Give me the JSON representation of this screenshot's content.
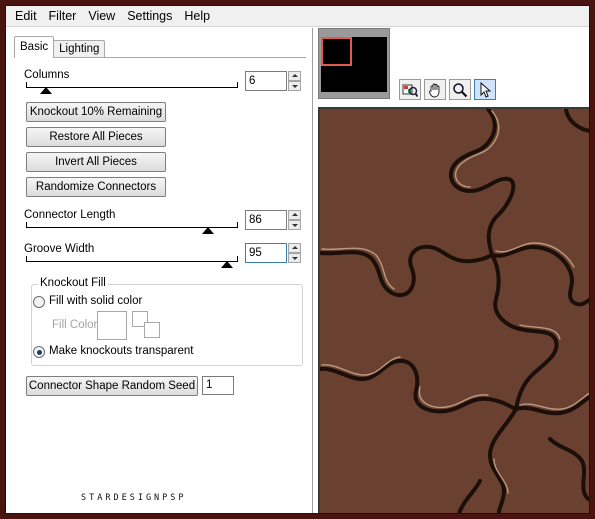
{
  "menu": [
    "Edit",
    "Filter",
    "View",
    "Settings",
    "Help"
  ],
  "tabs": {
    "basic": "Basic",
    "lighting": "Lighting"
  },
  "columns": {
    "label": "Columns",
    "value": "6"
  },
  "buttons": {
    "knockout": "Knockout 10% Remaining",
    "restore": "Restore All Pieces",
    "invert": "Invert All Pieces",
    "randomize": "Randomize Connectors",
    "seed": "Connector Shape Random Seed"
  },
  "connector_length": {
    "label": "Connector Length",
    "value": "86"
  },
  "groove_width": {
    "label": "Groove Width",
    "value": "95"
  },
  "knockout_fill": {
    "title": "Knockout Fill",
    "option_solid": "Fill with solid color",
    "fill_color_label": "Fill Color",
    "option_transparent": "Make knockouts transparent"
  },
  "seed_value": "1",
  "watermark": "STARDESIGNPSP",
  "tools": [
    "preview-map-icon",
    "hand-pan-icon",
    "zoom-icon",
    "pointer-arrow-icon"
  ],
  "colors": {
    "preview_brown": "#6a4131",
    "groove_dark": "#1c0f09",
    "highlight": "#c9a98f",
    "frame": "#4a1410",
    "thumbnail_marker": "#e35a50"
  }
}
